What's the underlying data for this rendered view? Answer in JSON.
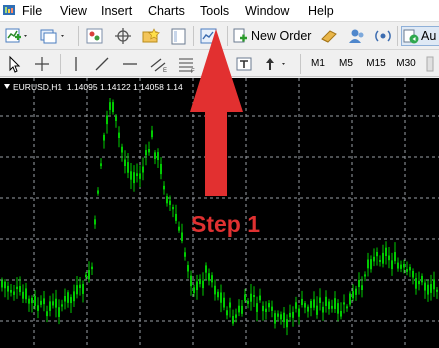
{
  "menubar": {
    "items": [
      "File",
      "View",
      "Insert",
      "Charts",
      "Tools",
      "Window",
      "Help"
    ]
  },
  "toolbar1": {
    "new_order_label": "New Order",
    "autotrading_label": "Au"
  },
  "toolbar2": {
    "timeframes": [
      "M1",
      "M5",
      "M15",
      "M30"
    ]
  },
  "chart": {
    "symbol": "EURUSD,H1",
    "open": "1.14095",
    "high": "1.14122",
    "low": "1.14058",
    "close_partial": "1.14",
    "background_color": "#000000",
    "candle_color": "#00cc00",
    "grid_color": "#9aa0a6"
  },
  "annotation": {
    "label": "Step 1",
    "color": "#e03131",
    "target_menu": "Tools"
  }
}
